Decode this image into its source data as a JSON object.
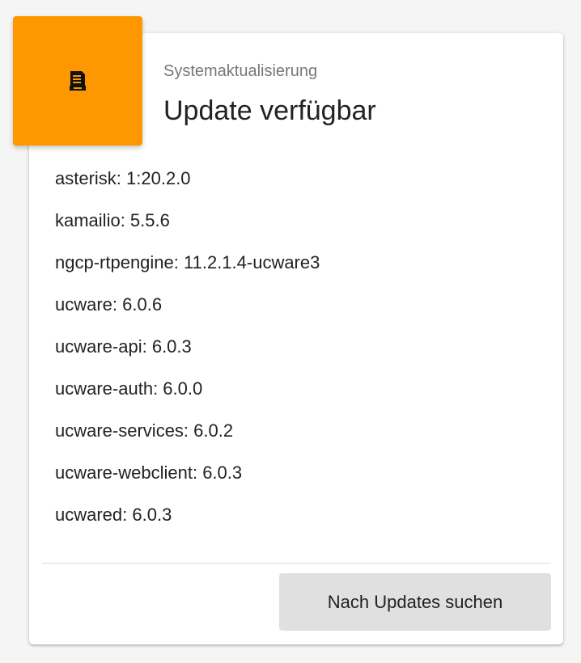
{
  "header": {
    "subtitle": "Systemaktualisierung",
    "title": "Update verfügbar",
    "icon": "changelog-document-icon",
    "accent_color": "#ff9800"
  },
  "packages": [
    "asterisk: 1:20.2.0",
    "kamailio: 5.5.6",
    "ngcp-rtpengine: 11.2.1.4-ucware3",
    "ucware: 6.0.6",
    "ucware-api: 6.0.3",
    "ucware-auth: 6.0.0",
    "ucware-services: 6.0.2",
    "ucware-webclient: 6.0.3",
    "ucwared: 6.0.3"
  ],
  "actions": {
    "check_updates_label": "Nach Updates suchen"
  }
}
